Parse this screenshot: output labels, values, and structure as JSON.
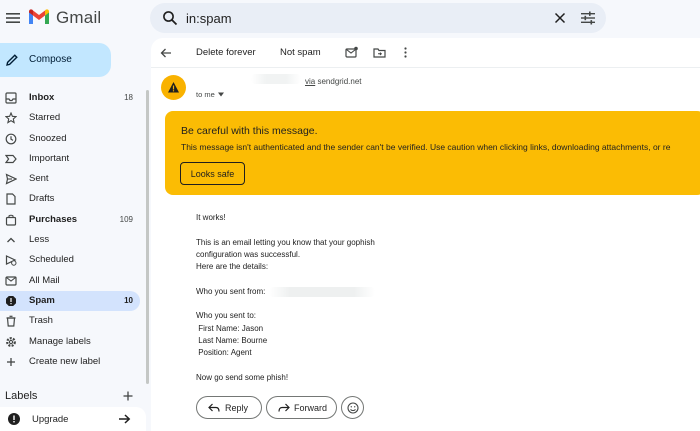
{
  "app": {
    "title": "Gmail"
  },
  "search": {
    "query": "in:spam"
  },
  "compose": {
    "label": "Compose"
  },
  "sidebar": {
    "items": [
      {
        "label": "Inbox",
        "count": "18",
        "icon": "inbox-icon"
      },
      {
        "label": "Starred",
        "count": "",
        "icon": "star-icon"
      },
      {
        "label": "Snoozed",
        "count": "",
        "icon": "clock-icon"
      },
      {
        "label": "Important",
        "count": "",
        "icon": "important-icon"
      },
      {
        "label": "Sent",
        "count": "",
        "icon": "send-icon"
      },
      {
        "label": "Drafts",
        "count": "",
        "icon": "draft-icon"
      },
      {
        "label": "Purchases",
        "count": "109",
        "icon": "shopping-bag-icon"
      },
      {
        "label": "Less",
        "count": "",
        "icon": "chevron-up-icon"
      },
      {
        "label": "Scheduled",
        "count": "",
        "icon": "scheduled-icon"
      },
      {
        "label": "All Mail",
        "count": "",
        "icon": "all-mail-icon"
      },
      {
        "label": "Spam",
        "count": "10",
        "icon": "spam-icon"
      },
      {
        "label": "Trash",
        "count": "",
        "icon": "trash-icon"
      },
      {
        "label": "Manage labels",
        "count": "",
        "icon": "gear-icon"
      },
      {
        "label": "Create new label",
        "count": "",
        "icon": "plus-icon"
      }
    ],
    "labels_heading": "Labels",
    "upgrade_label": "Upgrade"
  },
  "toolbar": {
    "delete_forever": "Delete forever",
    "not_spam": "Not spam"
  },
  "message": {
    "via_word": "via",
    "via_domain": "sendgrid.net",
    "to": "to me",
    "warning_title": "Be careful with this message.",
    "warning_text": "This message isn't authenticated and the sender can't be verified. Use caution when clicking links, downloading attachments, or re",
    "looks_safe": "Looks safe",
    "body": "It works!\n\nThis is an email letting you know that your gophish\nconfiguration was successful.\nHere are the details:\n\nWho you sent from:\n\nWho you sent to:\n First Name: Jason\n Last Name: Bourne\n Position: Agent\n\nNow go send some phish!"
  },
  "actions": {
    "reply": "Reply",
    "forward": "Forward"
  },
  "colors": {
    "accent": "#c2e7ff",
    "active": "#d3e3fd",
    "warning": "#fbbc04"
  }
}
